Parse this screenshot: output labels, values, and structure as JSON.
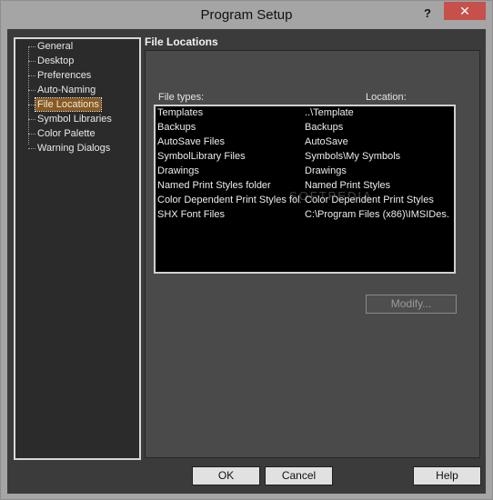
{
  "window": {
    "title": "Program Setup",
    "help_glyph": "?",
    "close_glyph": "✕"
  },
  "tree": {
    "items": [
      {
        "label": "General"
      },
      {
        "label": "Desktop"
      },
      {
        "label": "Preferences"
      },
      {
        "label": "Auto-Naming"
      },
      {
        "label": "File Locations",
        "selected": true
      },
      {
        "label": "Symbol Libraries"
      },
      {
        "label": "Color Palette"
      },
      {
        "label": "Warning Dialogs"
      }
    ]
  },
  "panel": {
    "title": "File Locations",
    "col_file_types": "File types:",
    "col_location": "Location:",
    "rows": [
      {
        "type": "Templates",
        "location": "..\\Template"
      },
      {
        "type": "Backups",
        "location": "Backups"
      },
      {
        "type": "AutoSave Files",
        "location": "AutoSave"
      },
      {
        "type": "SymbolLibrary Files",
        "location": "Symbols\\My Symbols"
      },
      {
        "type": "Drawings",
        "location": "Drawings"
      },
      {
        "type": "Named Print Styles folder",
        "location": "Named Print Styles"
      },
      {
        "type": "Color Dependent Print Styles fol...",
        "location": "Color Dependent Print Styles"
      },
      {
        "type": "SHX Font Files",
        "location": "C:\\Program Files (x86)\\IMSIDes..."
      }
    ],
    "watermark": "SOFTPEDIA",
    "modify_label": "Modify..."
  },
  "buttons": {
    "ok": "OK",
    "cancel": "Cancel",
    "help": "Help"
  }
}
